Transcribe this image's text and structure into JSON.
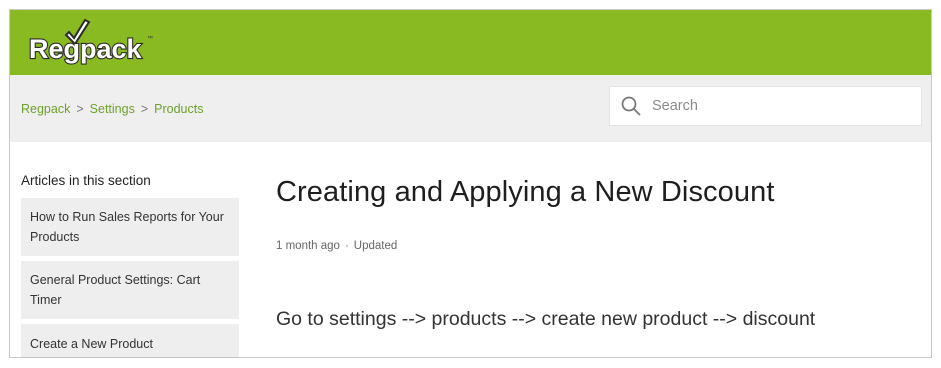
{
  "brand": {
    "logo_text": "Regpack",
    "header_color": "#8aba22",
    "accent_color": "#6ea12a"
  },
  "breadcrumb": {
    "items": [
      "Regpack",
      "Settings",
      "Products"
    ],
    "separator": ">"
  },
  "search": {
    "placeholder": "Search",
    "value": ""
  },
  "sidebar": {
    "title": "Articles in this section",
    "items": [
      {
        "label": "How to Run Sales Reports for Your Products"
      },
      {
        "label": "General Product Settings: Cart Timer"
      },
      {
        "label": "Create a New Product"
      }
    ]
  },
  "article": {
    "title": "Creating and Applying a New Discount",
    "age": "1 month ago",
    "separator": "·",
    "status": "Updated",
    "body": "Go to settings --> products --> create new product --> discount"
  }
}
